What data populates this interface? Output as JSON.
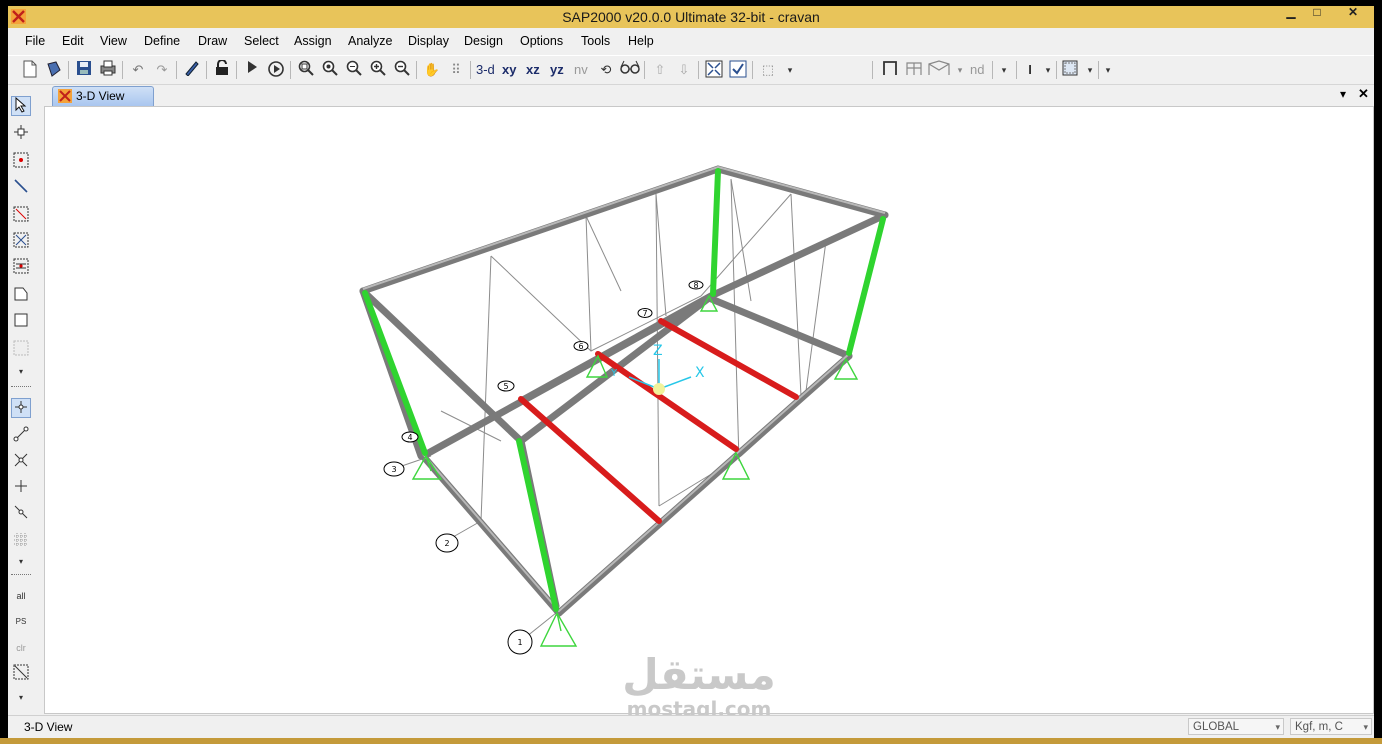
{
  "window": {
    "title": "SAP2000 v20.0.0 Ultimate 32-bit - cravan",
    "minimize": "▁",
    "maximize": "□",
    "close": "✕"
  },
  "menu": [
    "File",
    "Edit",
    "View",
    "Define",
    "Draw",
    "Select",
    "Assign",
    "Analyze",
    "Display",
    "Design",
    "Options",
    "Tools",
    "Help"
  ],
  "toolbar": {
    "view_3d": "3-d",
    "view_xy": "xy",
    "view_xz": "xz",
    "view_yz": "yz",
    "view_nv": "nv",
    "view_nd": "nd"
  },
  "left_tools": {
    "select_all": "all",
    "select_ps": "PS",
    "clear": "clr"
  },
  "tab": {
    "label": "3-D View",
    "dropdown": "▾",
    "close": "✕"
  },
  "model": {
    "axis_labels": {
      "z": "Z",
      "x": "X",
      "y": "Y"
    },
    "joint_labels": [
      "1",
      "2",
      "3",
      "4",
      "5",
      "6",
      "7",
      "8"
    ],
    "colors": {
      "frame": "#7a7a7a",
      "column": "#2fd42f",
      "beam": "#d81c1c",
      "support": "#3ed63e",
      "grid": "#8c8c8c",
      "axis": "#27c7e8"
    }
  },
  "status": {
    "view_name": "3-D View",
    "coord_system": "GLOBAL",
    "units": "Kgf, m, C"
  },
  "watermark": {
    "arabic": "مستقل",
    "latin": "mostaql.com"
  }
}
